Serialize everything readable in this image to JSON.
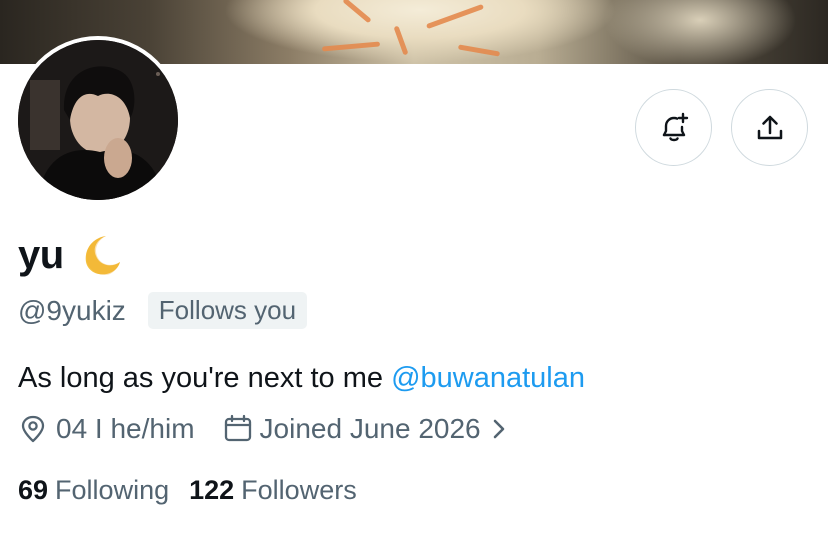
{
  "profile": {
    "display_name": "yu",
    "name_emoji": "crescent-moon",
    "handle": "@9yukiz",
    "follows_you_badge": "Follows you",
    "bio_text": "As long as you're next to me ",
    "bio_mention": "@buwanatulan",
    "location": "04 I he/him",
    "joined": "Joined June 2026",
    "following_count": "69",
    "following_label": "Following",
    "followers_count": "122",
    "followers_label": "Followers"
  },
  "actions": {
    "notifications_icon": "bell-plus-icon",
    "share_icon": "share-icon"
  },
  "colors": {
    "accent": "#1d9bf0",
    "text_primary": "#0f1419",
    "text_secondary": "#536471",
    "border": "#cfd9de",
    "moon": "#f5c242"
  }
}
